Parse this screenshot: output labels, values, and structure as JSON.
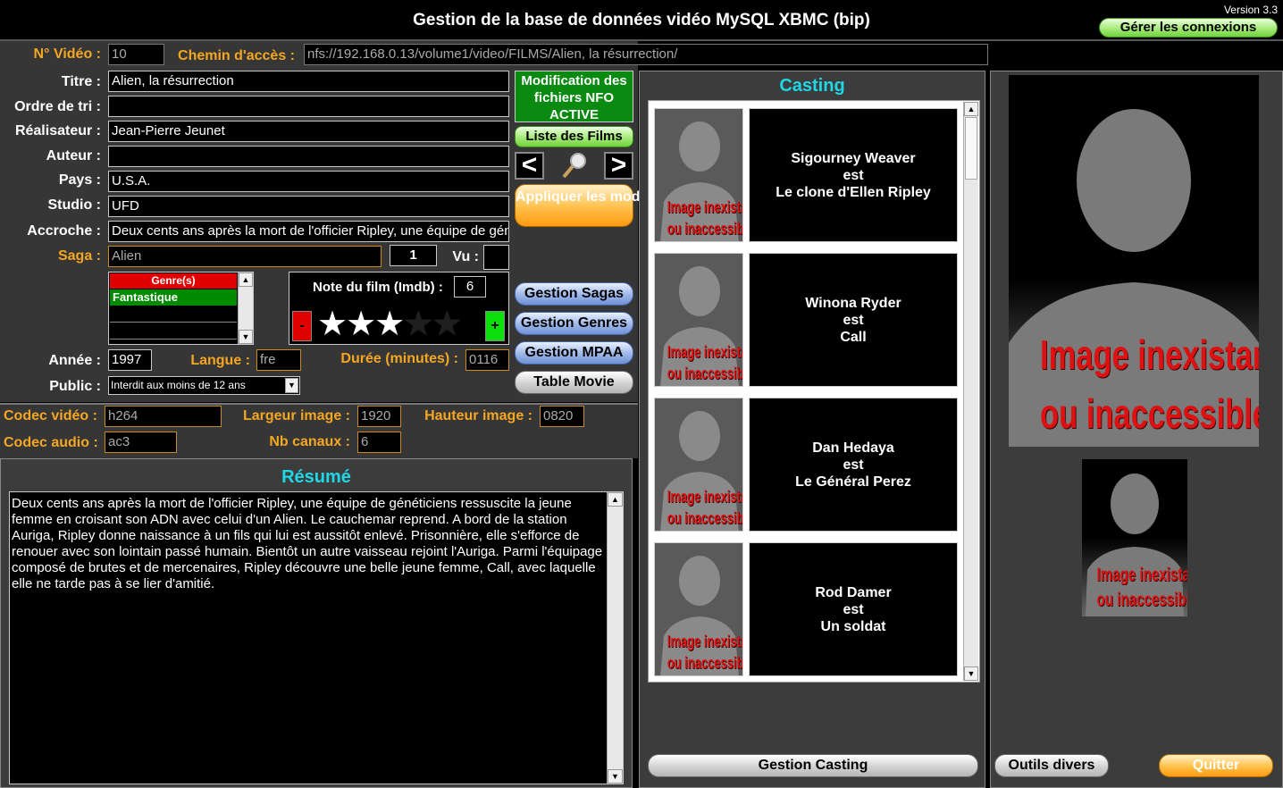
{
  "header": {
    "title": "Gestion de la base de données vidéo MySQL XBMC (bip)",
    "version": "Version 3.3",
    "connections_button": "Gérer les connexions"
  },
  "form": {
    "video_no_label": "N° Vidéo :",
    "video_no": "10",
    "path_label": "Chemin d'accès :",
    "path": "nfs://192.168.0.13/volume1/video/FILMS/Alien, la résurrection/",
    "title_label": "Titre :",
    "title": "Alien, la résurrection",
    "sort_label": "Ordre de tri :",
    "sort": "",
    "director_label": "Réalisateur :",
    "director": "Jean-Pierre Jeunet",
    "author_label": "Auteur :",
    "author": "",
    "country_label": "Pays :",
    "country": "U.S.A.",
    "studio_label": "Studio :",
    "studio": "UFD",
    "tagline_label": "Accroche :",
    "tagline": "Deux cents ans après la mort de l'officier Ripley, une équipe de généticiens ressuscite la jeune femme",
    "saga_label": "Saga :",
    "saga": "Alien",
    "saga_number": "1",
    "seen_label": "Vu :",
    "seen": "",
    "genres_header": "Genre(s)",
    "genres": [
      "Fantastique",
      "",
      ""
    ],
    "rating_label": "Note du film (Imdb) :",
    "rating": "6",
    "rating_minus": "-",
    "rating_plus": "+",
    "stars": [
      "★",
      "★",
      "★",
      "★",
      "★"
    ],
    "stars_filled": 3,
    "year_label": "Année :",
    "year": "1997",
    "language_label": "Langue :",
    "language": "fre",
    "duration_label": "Durée (minutes) :",
    "duration": "0116",
    "public_label": "Public :",
    "public": "Interdit aux moins de 12 ans",
    "vcodec_label": "Codec vidéo :",
    "vcodec": "h264",
    "width_label": "Largeur image :",
    "width": "1920",
    "height_label": "Hauteur image :",
    "height": "0820",
    "acodec_label": "Codec audio :",
    "acodec": "ac3",
    "channels_label": "Nb canaux :",
    "channels": "6"
  },
  "actions": {
    "nfo_status": "Modification des fichiers NFO ACTIVE",
    "film_list": "Liste des Films",
    "prev": "<",
    "next": ">",
    "apply": "Appliquer les modifications",
    "sagas": "Gestion Sagas",
    "genres": "Gestion Genres",
    "mpaa": "Gestion MPAA",
    "table_movie": "Table Movie"
  },
  "summary": {
    "title": "Résumé",
    "text": "Deux cents ans après la mort de l'officier Ripley, une équipe de généticiens ressuscite la jeune femme en croisant son ADN avec celui d'un Alien. Le cauchemar reprend. A bord de la station Auriga, Ripley donne naissance à un fils qui lui est aussitôt enlevé. Prisonnière, elle s'efforce de renouer avec son lointain passé humain. Bientôt un autre vaisseau rejoint l'Auriga. Parmi l'équipage composé de brutes et de mercenaires, Ripley découvre une belle jeune femme, Call, avec laquelle elle ne tarde pas à se lier d'amitié."
  },
  "casting": {
    "title": "Casting",
    "no_image_1": "Image inexistante",
    "no_image_2": "ou inaccessible",
    "is_word": "est",
    "entries": [
      {
        "actor": "Sigourney Weaver",
        "role": "Le clone d'Ellen Ripley"
      },
      {
        "actor": "Winona Ryder",
        "role": "Call"
      },
      {
        "actor": "Dan Hedaya",
        "role": "Le Général Perez"
      },
      {
        "actor": "Rod Damer",
        "role": "Un soldat"
      }
    ],
    "manage_button": "Gestion Casting"
  },
  "footer": {
    "tools_button": "Outils divers",
    "quit_button": "Quitter"
  },
  "colors": {
    "orange_label": "#f5a623",
    "cyan_title": "#1fd7e6",
    "genre_header": "#e00000",
    "genre_selected": "#008a00"
  }
}
